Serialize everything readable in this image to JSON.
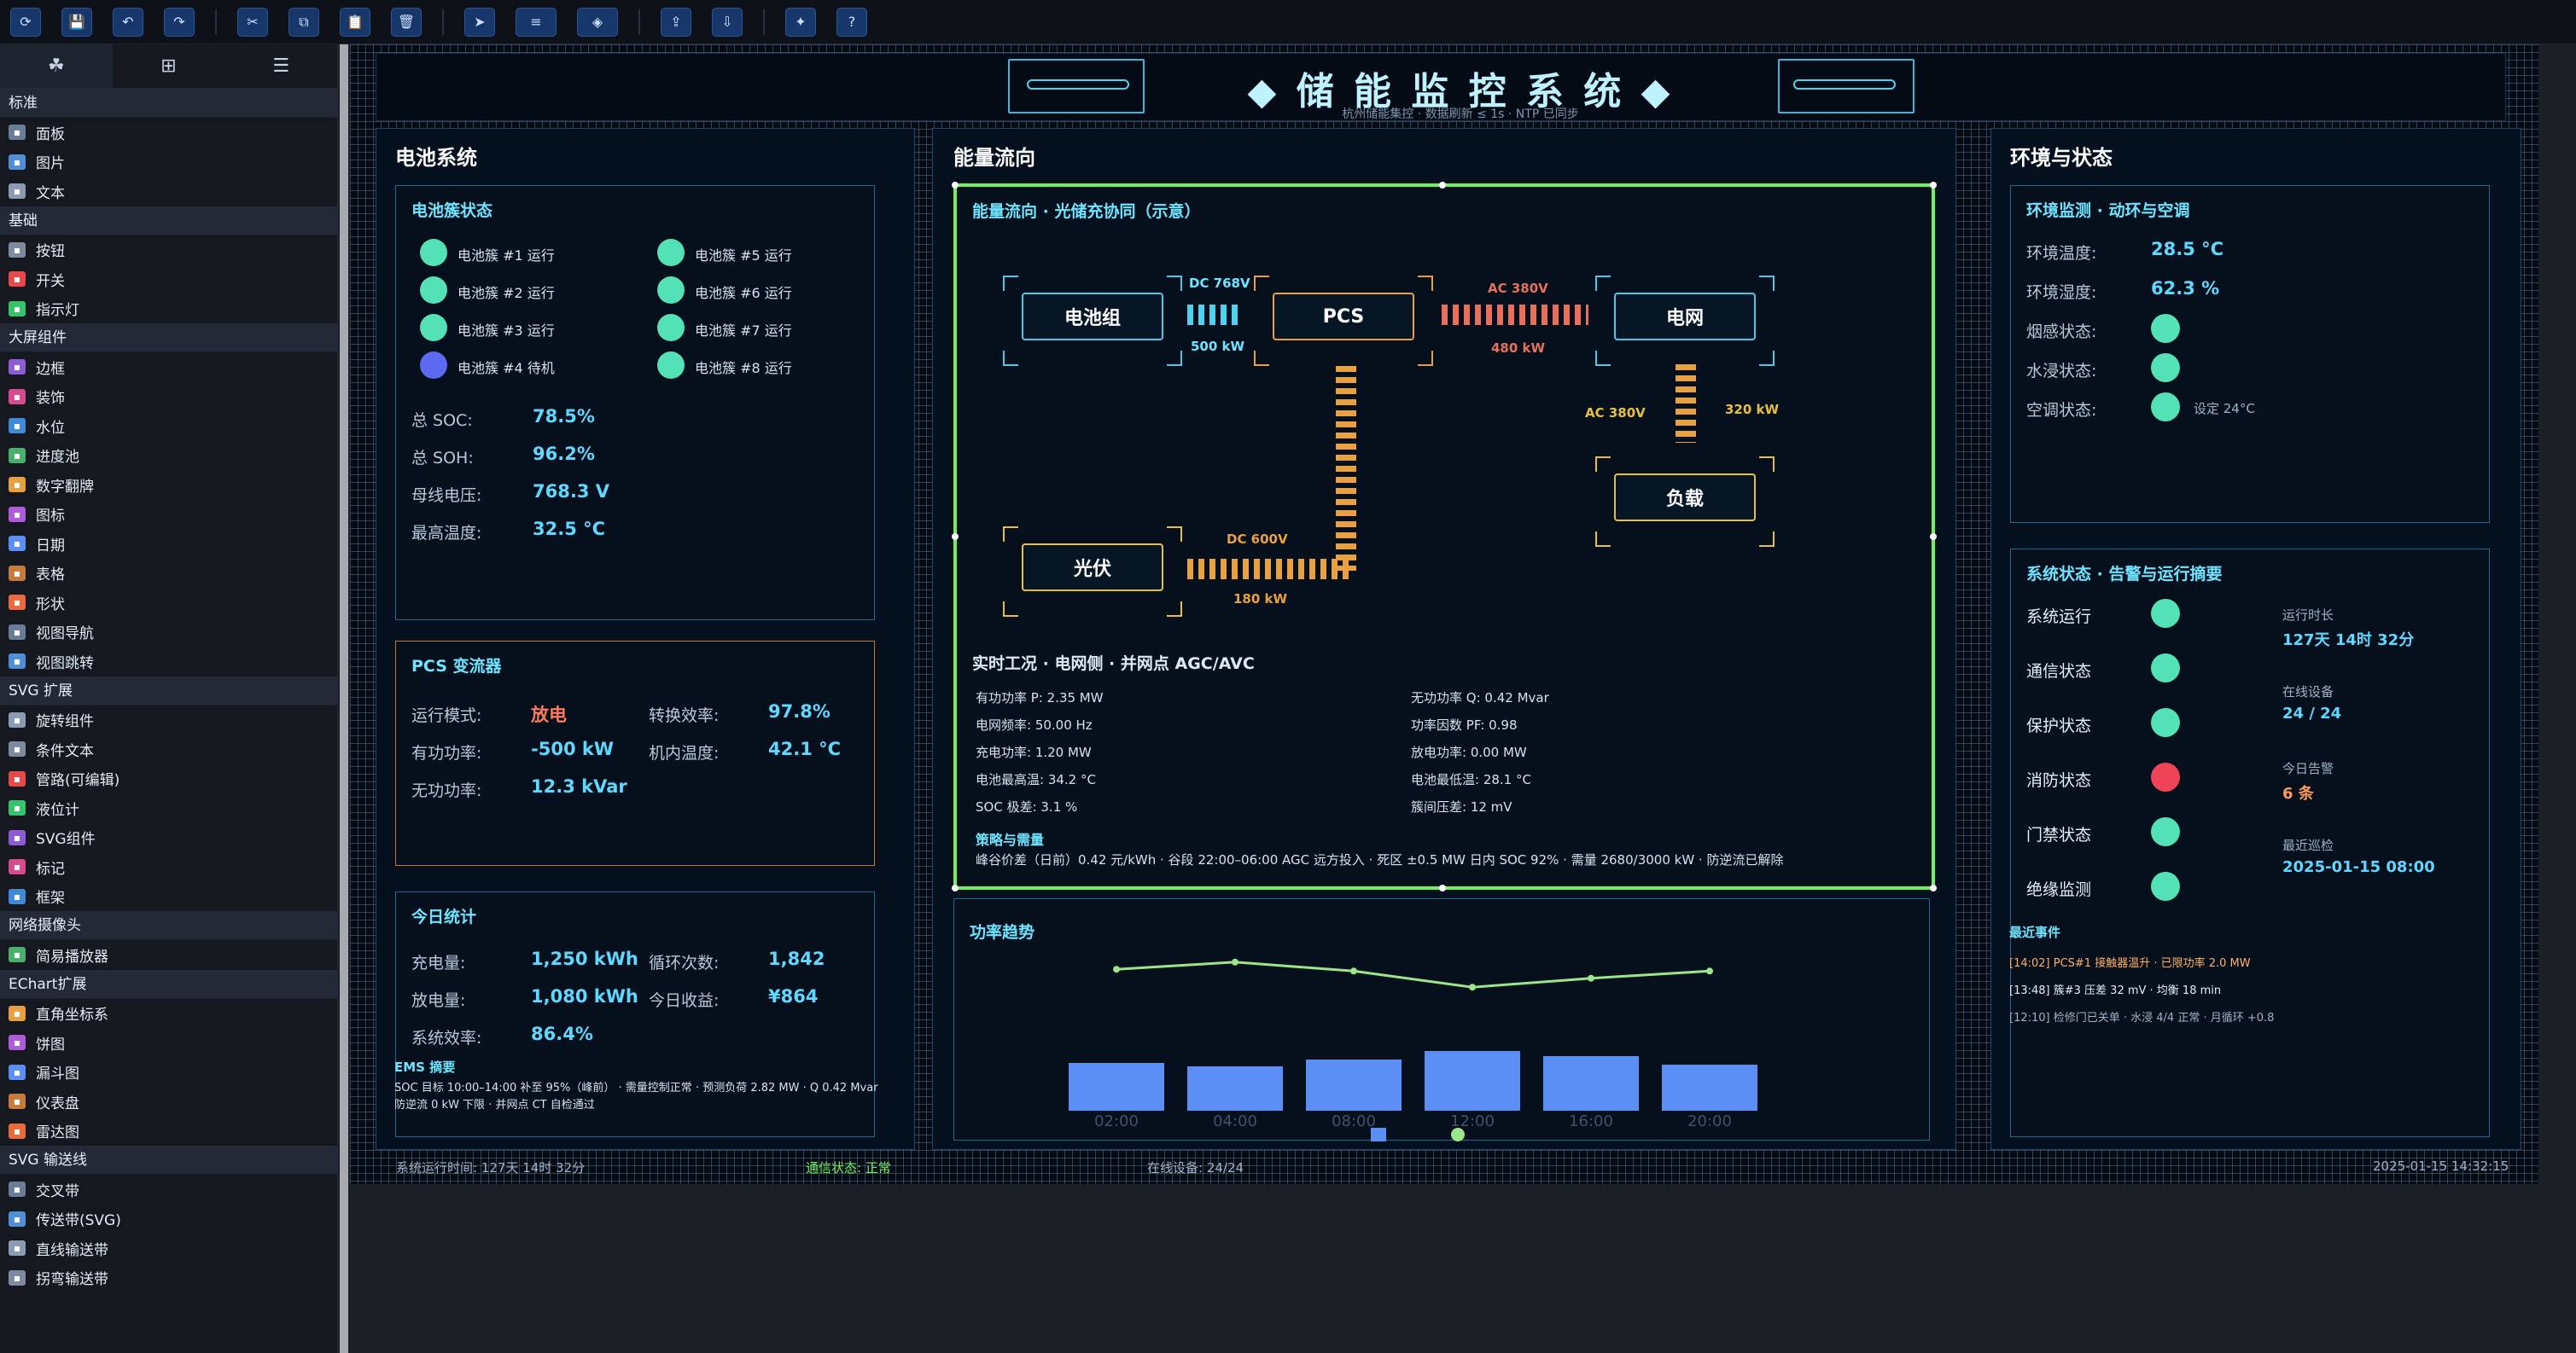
{
  "toolbar": {
    "buttons": [
      "refresh-icon",
      "save-icon",
      "undo-icon",
      "redo-icon",
      "cut-icon",
      "copy-icon",
      "paste-icon",
      "delete-icon",
      "pointer-icon",
      "align-icon",
      "layer-icon",
      "export-icon",
      "import-icon",
      "magic-icon",
      "help-icon"
    ]
  },
  "sidebar": {
    "categories": [
      {
        "name": "标准",
        "items": [
          "面板",
          "图片",
          "文本"
        ]
      },
      {
        "name": "基础",
        "items": [
          "按钮",
          "开关",
          "指示灯"
        ]
      },
      {
        "name": "大屏组件",
        "items": [
          "边框",
          "装饰",
          "水位",
          "进度池",
          "数字翻牌",
          "图标",
          "日期",
          "表格",
          "形状",
          "视图导航",
          "视图跳转"
        ]
      },
      {
        "name": "SVG 扩展",
        "items": [
          "旋转组件",
          "条件文本",
          "管路(可编辑)",
          "液位计",
          "SVG组件",
          "标记",
          "框架"
        ]
      },
      {
        "name": "网络摄像头",
        "items": [
          "简易播放器"
        ]
      },
      {
        "name": "EChart扩展",
        "items": [
          "直角坐标系",
          "饼图",
          "漏斗图",
          "仪表盘",
          "雷达图"
        ]
      },
      {
        "name": "SVG 输送线",
        "items": [
          "交叉带",
          "传送带(SVG)",
          "直线输送带",
          "拐弯输送带"
        ]
      }
    ]
  },
  "header": {
    "title": "◆ 储 能 监 控 系 统 ◆",
    "subtitle": "杭州储能集控 · 数据刷新 ≤ 1s · NTP 已同步"
  },
  "battery": {
    "panel_title": "电池系统",
    "cluster_title": "电池簇状态",
    "clusters": [
      "电池簇 #1 运行",
      "电池簇 #2 运行",
      "电池簇 #3 运行",
      "电池簇 #4 待机",
      "电池簇 #5 运行",
      "电池簇 #6 运行",
      "电池簇 #7 运行",
      "电池簇 #8 运行"
    ],
    "cluster_colors": [
      "#53e2b5",
      "#53e2b5",
      "#53e2b5",
      "#5b6af0",
      "#53e2b5",
      "#53e2b5",
      "#53e2b5",
      "#53e2b5"
    ],
    "stats": [
      {
        "k": "总 SOC:",
        "v": "78.5%"
      },
      {
        "k": "总 SOH:",
        "v": "96.2%"
      },
      {
        "k": "母线电压:",
        "v": "768.3 V"
      },
      {
        "k": "最高温度:",
        "v": "32.5 °C"
      }
    ]
  },
  "pcs": {
    "title": "PCS 变流器",
    "rows": [
      {
        "k": "运行模式:",
        "v": "放电"
      },
      {
        "k": "转换效率:",
        "v": "97.8%"
      },
      {
        "k": "有功功率:",
        "v": "-500 kW"
      },
      {
        "k": "机内温度:",
        "v": "42.1 °C"
      },
      {
        "k": "无功功率:",
        "v": "12.3 kVar"
      }
    ]
  },
  "today": {
    "title": "今日统计",
    "rows": [
      {
        "k": "充电量:",
        "v": "1,250 kWh"
      },
      {
        "k": "循环次数:",
        "v": "1,842"
      },
      {
        "k": "放电量:",
        "v": "1,080 kWh"
      },
      {
        "k": "今日收益:",
        "v": "¥864"
      },
      {
        "k": "系统效率:",
        "v": "86.4%"
      }
    ],
    "ems_title": "EMS 摘要",
    "ems_line1": "SOC 目标 10:00–14:00 补至 95%（峰前） · 需量控制正常 · 预测负荷 2.82 MW · Q 0.42 Mvar",
    "ems_line2": "防逆流 0 kW 下限 · 并网点 CT 自检通过"
  },
  "energy": {
    "panel_title": "能量流向",
    "flow_title": "能量流向 · 光储充协同（示意）",
    "nodes": {
      "battery": "电池组",
      "pcs": "PCS",
      "grid": "电网",
      "pv": "光伏",
      "load": "负载"
    },
    "labels": {
      "dc768": "DC 768V",
      "p500": "500 kW",
      "ac380a": "AC 380V",
      "p480": "480 kW",
      "ac380b": "AC 380V",
      "p320": "320 kW",
      "dc600": "DC 600V",
      "p180": "180 kW"
    },
    "rt_title": "实时工况 · 电网侧 · 并网点 AGC/AVC",
    "rt_rows": [
      "有功功率 P:  2.35 MW",
      "无功功率 Q:  0.42 Mvar",
      "电网频率:  50.00 Hz",
      "功率因数 PF:  0.98",
      "充电功率:  1.20 MW",
      "放电功率:  0.00 MW",
      "电池最高温:  34.2 °C",
      "电池最低温:  28.1 °C",
      "SOC 极差:  3.1 %",
      "簇间压差:  12 mV"
    ],
    "strategy_title": "策略与需量",
    "strategy_text": "峰谷价差（日前）0.42 元/kWh · 谷段 22:00–06:00 AGC 远方投入 · 死区 ±0.5 MW 日内 SOC 92% · 需量 2680/3000 kW · 防逆流已解除"
  },
  "trend": {
    "title": "功率趋势"
  },
  "chart_data": {
    "type": "bar",
    "title": "功率趋势",
    "categories": [
      "02:00",
      "04:00",
      "08:00",
      "12:00",
      "16:00",
      "20:00"
    ],
    "series": [
      {
        "type": "bar",
        "values": [
          28,
          26,
          30,
          35,
          32,
          27
        ]
      },
      {
        "type": "line",
        "values": [
          78,
          82,
          77,
          68,
          73,
          77
        ]
      }
    ],
    "colors": [
      "#5b8ff5",
      "#9be58a"
    ]
  },
  "env": {
    "panel_title": "环境与状态",
    "title": "环境监测 · 动环与空调",
    "rows": [
      {
        "k": "环境温度:",
        "v": "28.5 °C"
      },
      {
        "k": "环境湿度:",
        "v": "62.3 %"
      },
      {
        "k": "烟感状态:"
      },
      {
        "k": "水浸状态:"
      },
      {
        "k": "空调状态:",
        "note": "设定 24°C"
      }
    ]
  },
  "sys": {
    "title": "系统状态 · 告警与运行摘要",
    "items": [
      {
        "k": "系统运行",
        "c": "#53e2b5"
      },
      {
        "k": "通信状态",
        "c": "#53e2b5"
      },
      {
        "k": "保护状态",
        "c": "#53e2b5"
      },
      {
        "k": "消防状态",
        "c": "#ef4458"
      },
      {
        "k": "门禁状态",
        "c": "#53e2b5"
      },
      {
        "k": "绝缘监测",
        "c": "#53e2b5"
      }
    ],
    "summary": [
      {
        "k": "运行时长",
        "v": "127天 14时 32分"
      },
      {
        "k": "在线设备",
        "v": "24 / 24"
      },
      {
        "k": "今日告警",
        "v": "6 条"
      },
      {
        "k": "最近巡检",
        "v": "2025-01-15 08:00"
      }
    ],
    "events_title": "最近事件",
    "events": [
      "[14:02] PCS#1 接触器温升 · 已限功率 2.0 MW",
      "[13:48] 簇#3 压差 32 mV · 均衡 18 min",
      "[12:10] 检修门已关单 · 水浸 4/4 正常 · 月循环 +0.8"
    ]
  },
  "footer": {
    "runtime": "系统运行时间: 127天 14时 32分",
    "comm": "通信状态: 正常",
    "devices": "在线设备: 24/24",
    "time": "2025-01-15 14:32:15"
  }
}
